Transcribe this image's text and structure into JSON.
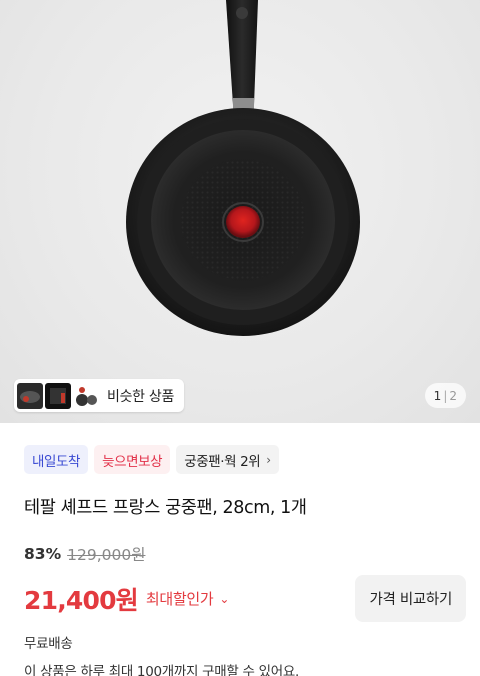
{
  "gallery": {
    "similar_label": "비슷한 상품",
    "pager_current": "1",
    "pager_total": "2",
    "thumbnails": [
      "pan-thumb-1",
      "pan-thumb-2",
      "pan-thumb-3"
    ]
  },
  "badges": {
    "tomorrow": "내일도착",
    "late_comp": "늦으면보상",
    "rank": "궁중팬·웍 2위"
  },
  "product": {
    "title": "테팔 셰프드 프랑스 궁중팬, 28cm, 1개",
    "discount": "83%",
    "original_price": "129,000원",
    "sale_price": "21,400원",
    "max_discount_label": "최대할인가",
    "compare_button": "가격 비교하기",
    "shipping": "무료배송",
    "limit_notice": "이 상품은 하루 최대 100개까지 구매할 수 있어요."
  },
  "colors": {
    "accent_red": "#e33a3f",
    "badge_blue": "#3b4bd3",
    "badge_red": "#e2324a"
  }
}
